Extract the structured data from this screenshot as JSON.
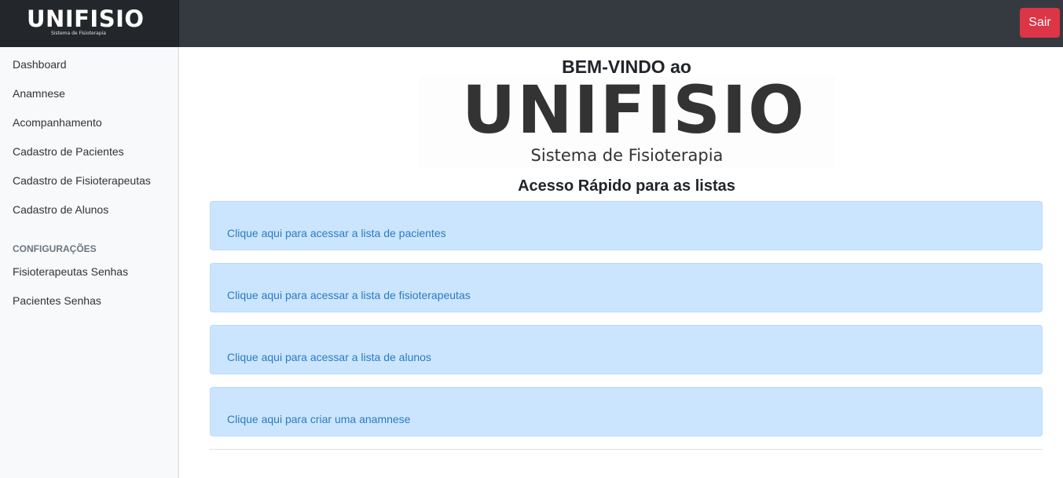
{
  "header": {
    "brand_name": "UNIFISIO",
    "brand_subtitle": "Sistema de Fisioterapia",
    "logout_label": "Sair",
    "logout_color": "#dc3545",
    "bar_color": "#343a40"
  },
  "sidebar": {
    "items": [
      {
        "label": "Dashboard"
      },
      {
        "label": "Anamnese"
      },
      {
        "label": "Acompanhamento"
      },
      {
        "label": "Cadastro de Pacientes"
      },
      {
        "label": "Cadastro de Fisioterapeutas"
      },
      {
        "label": "Cadastro de Alunos"
      }
    ],
    "section_heading": "CONFIGURAÇÕES",
    "config_items": [
      {
        "label": "Fisioterapeutas Senhas"
      },
      {
        "label": "Pacientes Senhas"
      }
    ]
  },
  "main": {
    "welcome": "BEM-VINDO ao",
    "logo_name": "UNIFISIO",
    "logo_subtitle": "Sistema de Fisioterapia",
    "quick_access_title": "Acesso Rápido para as listas",
    "cards": [
      {
        "link_text": "Clique aqui para acessar a lista de pacientes"
      },
      {
        "link_text": "Clique aqui para acessar a lista de fisioterapeutas"
      },
      {
        "link_text": "Clique aqui para acessar a lista de alunos"
      },
      {
        "link_text": "Clique aqui para criar uma anamnese"
      }
    ],
    "card_color": "#cce5ff",
    "link_color": "#2a7bc0"
  }
}
